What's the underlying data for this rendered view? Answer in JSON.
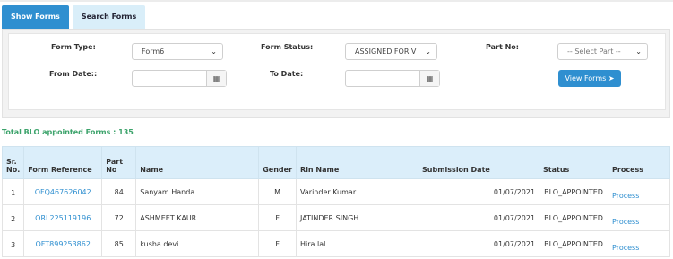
{
  "tabs": {
    "show_forms": "Show Forms",
    "search_forms": "Search Forms"
  },
  "filters": {
    "form_type_label": "Form Type:",
    "form_type_value": "Form6",
    "form_status_label": "Form Status:",
    "form_status_value": "ASSIGNED FOR V",
    "part_no_label": "Part No:",
    "part_no_value": "-- Select Part --",
    "from_date_label": "From Date::",
    "to_date_label": "To Date:",
    "view_forms_label": "View Forms",
    "view_forms_icon": "arrow-circle-right-icon",
    "calendar_icon": "calendar-icon"
  },
  "total_text": "Total BLO appointed Forms : 135",
  "table": {
    "headers": [
      "Sr. No.",
      "Form Reference",
      "Part No",
      "Name",
      "Gender",
      "Rln Name",
      "Submission Date",
      "Status",
      "Process"
    ],
    "rows": [
      {
        "sr": "1",
        "ref": "OFQ467626042",
        "part": "84",
        "name": "Sanyam Handa",
        "gender": "M",
        "rln": "Varinder Kumar",
        "date": "01/07/2021",
        "status": "BLO_APPOINTED",
        "process": "Process"
      },
      {
        "sr": "2",
        "ref": "ORL225119196",
        "part": "72",
        "name": "ASHMEET KAUR",
        "gender": "F",
        "rln": "JATINDER SINGH",
        "date": "01/07/2021",
        "status": "BLO_APPOINTED",
        "process": "Process"
      },
      {
        "sr": "3",
        "ref": "OFT899253862",
        "part": "85",
        "name": "kusha devi",
        "gender": "F",
        "rln": "Hira lal",
        "date": "01/07/2021",
        "status": "BLO_APPOINTED",
        "process": "Process"
      }
    ]
  },
  "colors": {
    "accent": "#2f8fd0",
    "total_text": "#3ca36b",
    "header_bg": "#dbeefa"
  }
}
